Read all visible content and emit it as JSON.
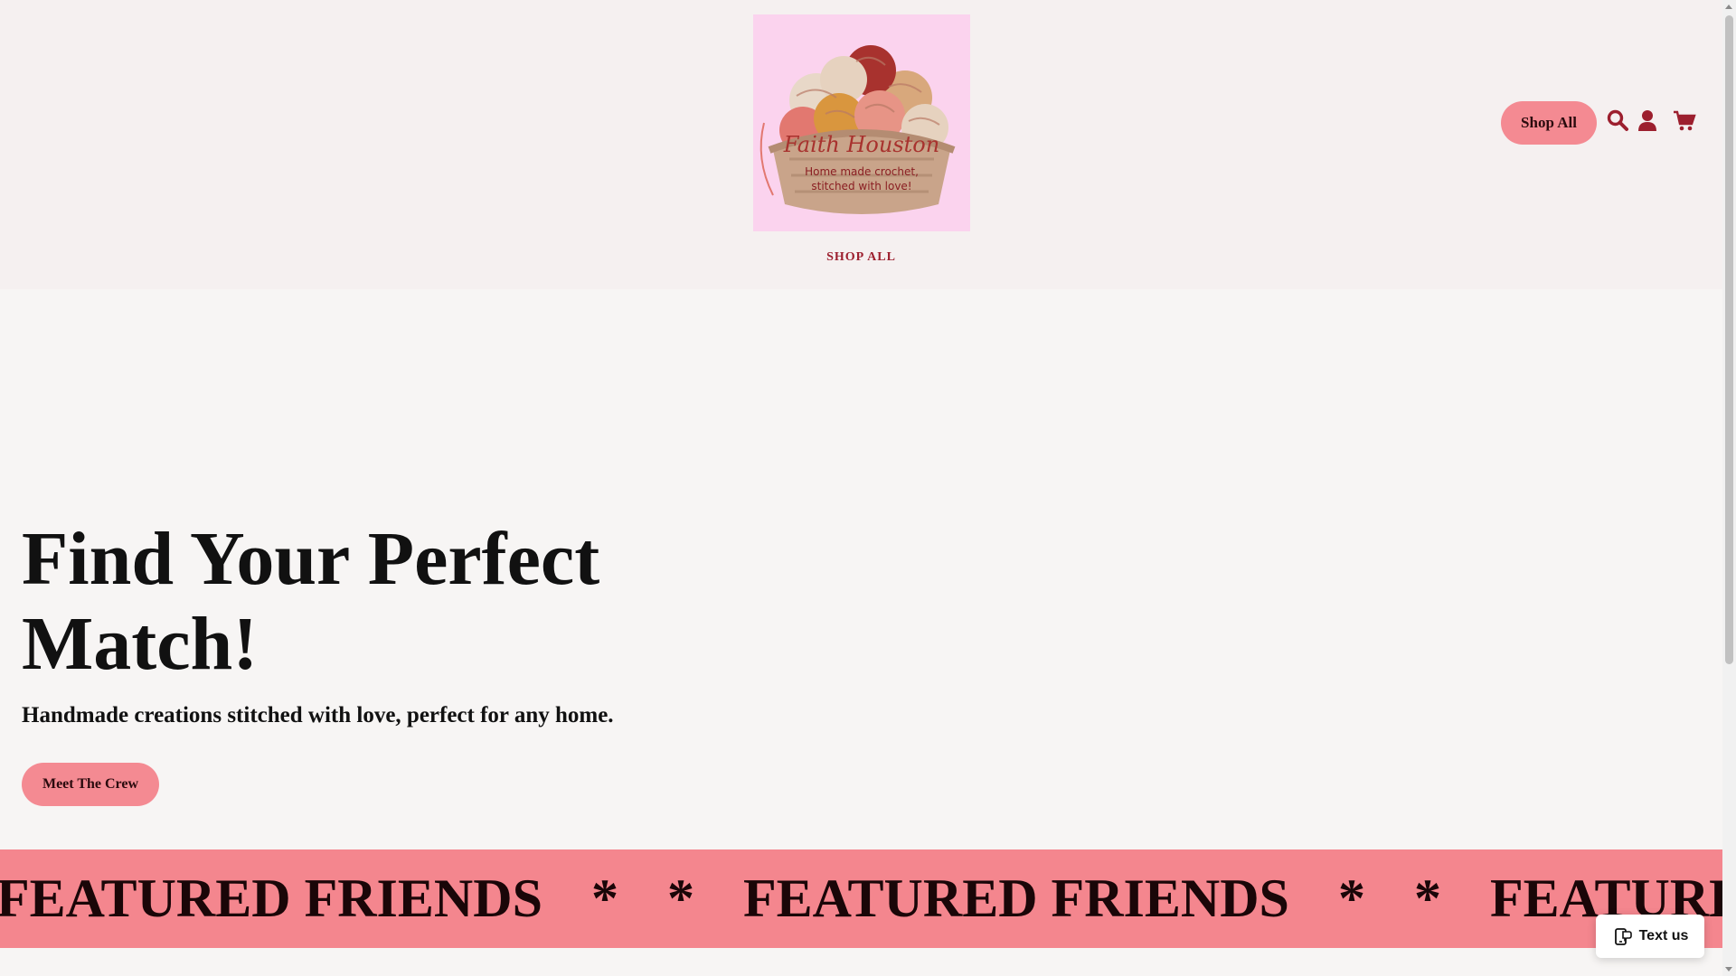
{
  "header": {
    "logo": {
      "brand": "Faith Houston",
      "tagline_line1": "Home made crochet,",
      "tagline_line2": "stitched with love!"
    },
    "nav": {
      "shop_all": "SHOP ALL"
    },
    "shop_all_button": "Shop All",
    "icons": [
      "search-icon",
      "account-icon",
      "cart-icon"
    ]
  },
  "hero": {
    "title": "Find Your Perfect Match!",
    "subtitle": "Handmade creations stitched with love, perfect for any home.",
    "cta": "Meet The Crew"
  },
  "marquee": {
    "text": "FEATURED FRIENDS",
    "separator": "*"
  },
  "chat_widget": {
    "label": "Text us",
    "icon": "message-icon"
  },
  "colors": {
    "accent": "#f4868e",
    "header_bg": "#f5f0f0",
    "page_bg": "#f7f5f4",
    "nav_text": "#9c1f2e",
    "logo_bg": "#fbd3ee"
  }
}
